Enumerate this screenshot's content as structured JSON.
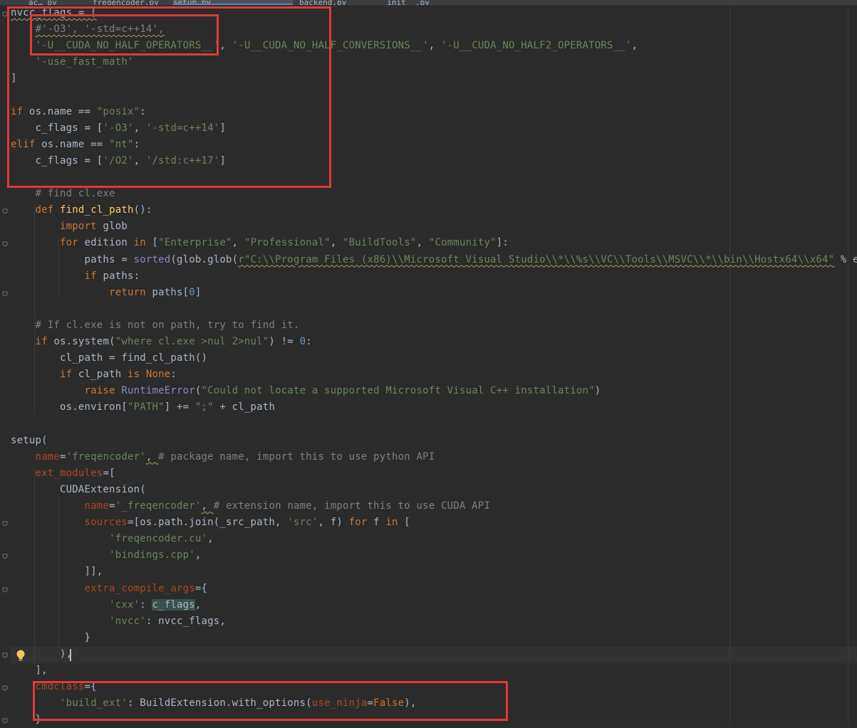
{
  "tabs": [
    "ac… py",
    "freqencoder.py",
    "backend.py",
    "setup.py",
    "__init__.py"
  ],
  "code_lines": [
    [
      {
        "t": "nvcc_flags = [",
        "c": "warn"
      }
    ],
    [
      {
        "t": "    "
      },
      {
        "t": "#'-O3', '-std=c++14',",
        "c": "cmt warn"
      }
    ],
    [
      {
        "t": "    "
      },
      {
        "t": "'-U__CUDA_NO_HALF_OPERATORS__'",
        "c": "str"
      },
      {
        "t": ", "
      },
      {
        "t": "'-U__CUDA_NO_HALF_CONVERSIONS__'",
        "c": "str"
      },
      {
        "t": ", "
      },
      {
        "t": "'-U__CUDA_NO_HALF2_OPERATORS__'",
        "c": "str"
      },
      {
        "t": ","
      }
    ],
    [
      {
        "t": "    "
      },
      {
        "t": "'-use_fast_math'",
        "c": "str"
      }
    ],
    [
      {
        "t": "]"
      }
    ],
    [
      {
        "t": ""
      }
    ],
    [
      {
        "t": "if",
        "c": "kw"
      },
      {
        "t": " os.name == "
      },
      {
        "t": "\"posix\"",
        "c": "str"
      },
      {
        "t": ":"
      }
    ],
    [
      {
        "t": "    c_flags = ["
      },
      {
        "t": "'-O3'",
        "c": "str"
      },
      {
        "t": ", "
      },
      {
        "t": "'-std=c++14'",
        "c": "str"
      },
      {
        "t": "]"
      }
    ],
    [
      {
        "t": "elif",
        "c": "kw"
      },
      {
        "t": " os.name == "
      },
      {
        "t": "\"nt\"",
        "c": "str"
      },
      {
        "t": ":"
      }
    ],
    [
      {
        "t": "    c_flags = ["
      },
      {
        "t": "'/O2'",
        "c": "str"
      },
      {
        "t": ", "
      },
      {
        "t": "'/std:c++17'",
        "c": "str"
      },
      {
        "t": "]"
      }
    ],
    [
      {
        "t": ""
      }
    ],
    [
      {
        "t": "    "
      },
      {
        "t": "# find cl.exe",
        "c": "cmt"
      }
    ],
    [
      {
        "t": "    "
      },
      {
        "t": "def",
        "c": "kw"
      },
      {
        "t": " "
      },
      {
        "t": "find_cl_path",
        "c": "fn"
      },
      {
        "t": "():"
      }
    ],
    [
      {
        "t": "        "
      },
      {
        "t": "import",
        "c": "kw"
      },
      {
        "t": " glob"
      }
    ],
    [
      {
        "t": "        "
      },
      {
        "t": "for",
        "c": "kw"
      },
      {
        "t": " edition "
      },
      {
        "t": "in",
        "c": "kw"
      },
      {
        "t": " ["
      },
      {
        "t": "\"Enterprise\"",
        "c": "str"
      },
      {
        "t": ", "
      },
      {
        "t": "\"Professional\"",
        "c": "str"
      },
      {
        "t": ", "
      },
      {
        "t": "\"BuildTools\"",
        "c": "str"
      },
      {
        "t": ", "
      },
      {
        "t": "\"Community\"",
        "c": "str"
      },
      {
        "t": "]:"
      }
    ],
    [
      {
        "t": "            paths = "
      },
      {
        "t": "sorted",
        "c": "bi"
      },
      {
        "t": "(glob.glob("
      },
      {
        "t": "r\"C:\\\\Program Files (x86)\\\\Microsoft Visual Studio\\\\*\\\\%s\\\\VC\\\\Tools\\\\MSVC\\\\*\\\\bin\\\\Hostx64\\\\x64\"",
        "c": "str warn"
      },
      {
        "t": " % edition"
      }
    ],
    [
      {
        "t": "            "
      },
      {
        "t": "if",
        "c": "kw"
      },
      {
        "t": " paths:"
      }
    ],
    [
      {
        "t": "                "
      },
      {
        "t": "return",
        "c": "kw"
      },
      {
        "t": " paths["
      },
      {
        "t": "0",
        "c": "num"
      },
      {
        "t": "]"
      }
    ],
    [
      {
        "t": ""
      }
    ],
    [
      {
        "t": "    "
      },
      {
        "t": "# If cl.exe is not on path, try to find it.",
        "c": "cmt"
      }
    ],
    [
      {
        "t": "    "
      },
      {
        "t": "if",
        "c": "kw"
      },
      {
        "t": " os.system("
      },
      {
        "t": "\"where cl.exe >nul 2>nul\"",
        "c": "str"
      },
      {
        "t": ") != "
      },
      {
        "t": "0",
        "c": "num"
      },
      {
        "t": ":"
      }
    ],
    [
      {
        "t": "        cl_path = find_cl_path()"
      }
    ],
    [
      {
        "t": "        "
      },
      {
        "t": "if",
        "c": "kw"
      },
      {
        "t": " cl_path "
      },
      {
        "t": "is",
        "c": "kw"
      },
      {
        "t": " "
      },
      {
        "t": "None",
        "c": "kw"
      },
      {
        "t": ":"
      }
    ],
    [
      {
        "t": "            "
      },
      {
        "t": "raise",
        "c": "kw"
      },
      {
        "t": " "
      },
      {
        "t": "RuntimeError",
        "c": "bi"
      },
      {
        "t": "("
      },
      {
        "t": "\"Could not locate a supported Microsoft Visual C++ installation\"",
        "c": "str"
      },
      {
        "t": ")"
      }
    ],
    [
      {
        "t": "        os.environ["
      },
      {
        "t": "\"PATH\"",
        "c": "str"
      },
      {
        "t": "] += "
      },
      {
        "t": "\";\"",
        "c": "str"
      },
      {
        "t": " + cl_path"
      }
    ],
    [
      {
        "t": ""
      }
    ],
    [
      {
        "t": "setup("
      }
    ],
    [
      {
        "t": "    "
      },
      {
        "t": "name",
        "c": "param"
      },
      {
        "t": "="
      },
      {
        "t": "'freqencoder'",
        "c": "str"
      },
      {
        "t": ", ",
        "c": "warn"
      },
      {
        "t": "# package name, import this to use python API",
        "c": "cmt"
      }
    ],
    [
      {
        "t": "    "
      },
      {
        "t": "ext_modules",
        "c": "param"
      },
      {
        "t": "=["
      }
    ],
    [
      {
        "t": "        CUDAExtension("
      }
    ],
    [
      {
        "t": "            "
      },
      {
        "t": "name",
        "c": "param"
      },
      {
        "t": "="
      },
      {
        "t": "'_freqencoder'",
        "c": "str"
      },
      {
        "t": ", ",
        "c": "warn"
      },
      {
        "t": "# extension name, import this to use CUDA API",
        "c": "cmt"
      }
    ],
    [
      {
        "t": "            "
      },
      {
        "t": "sources",
        "c": "param"
      },
      {
        "t": "=[os.path.join(_src_path, "
      },
      {
        "t": "'src'",
        "c": "str"
      },
      {
        "t": ", f) "
      },
      {
        "t": "for",
        "c": "kw"
      },
      {
        "t": " f "
      },
      {
        "t": "in",
        "c": "kw"
      },
      {
        "t": " ["
      }
    ],
    [
      {
        "t": "                "
      },
      {
        "t": "'freqencoder.cu'",
        "c": "str"
      },
      {
        "t": ","
      }
    ],
    [
      {
        "t": "                "
      },
      {
        "t": "'bindings.cpp'",
        "c": "str"
      },
      {
        "t": ","
      }
    ],
    [
      {
        "t": "            ]],"
      }
    ],
    [
      {
        "t": "            "
      },
      {
        "t": "extra_compile_args",
        "c": "param"
      },
      {
        "t": "={"
      }
    ],
    [
      {
        "t": "                "
      },
      {
        "t": "'cxx'",
        "c": "str"
      },
      {
        "t": ": "
      },
      {
        "t": "c_flags",
        "c": "hl"
      },
      {
        "t": ","
      }
    ],
    [
      {
        "t": "                "
      },
      {
        "t": "'nvcc'",
        "c": "str"
      },
      {
        "t": ": nvcc_flags,"
      }
    ],
    [
      {
        "t": "            }"
      }
    ],
    [
      {
        "t": "        ),"
      }
    ],
    [
      {
        "t": "    ],"
      }
    ],
    [
      {
        "t": "    "
      },
      {
        "t": "cmdclass",
        "c": "param"
      },
      {
        "t": "={"
      }
    ],
    [
      {
        "t": "        "
      },
      {
        "t": "'build_ext'",
        "c": "str"
      },
      {
        "t": ": BuildExtension.with_options("
      },
      {
        "t": "use_ninja",
        "c": "param"
      },
      {
        "t": "="
      },
      {
        "t": "False",
        "c": "kw"
      },
      {
        "t": "),"
      }
    ],
    [
      {
        "t": "    }"
      }
    ]
  ],
  "annotation_color": "#e0393a",
  "icons": {
    "bulb": "lightbulb-icon",
    "fold": "fold-marker-icon"
  }
}
